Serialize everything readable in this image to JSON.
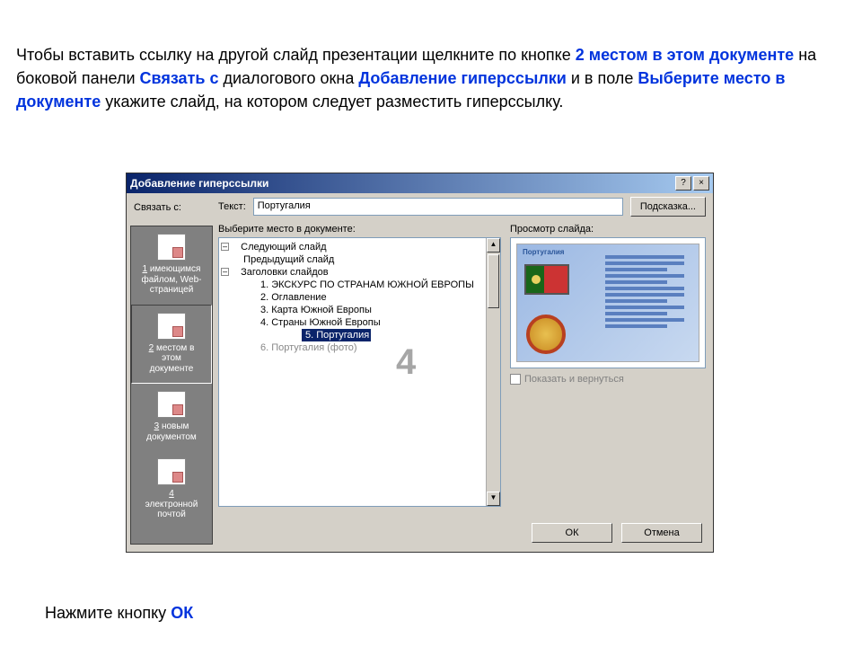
{
  "instruction": {
    "p1a": "Чтобы вставить ссылку на другой слайд презентации щелкните по кнопке ",
    "p1b": "2 местом в этом документе",
    "p1c": " на боковой панели ",
    "p1d": "Связать с",
    "p1e": " диалогового окна ",
    "p1f": "Добавление гиперссылки",
    "p1g": " и в поле ",
    "p1h": "Выберите место в документе",
    "p1i": " укажите слайд, на котором следует разместить гиперссылку."
  },
  "bottom": {
    "a": "Нажмите кнопку ",
    "b": "ОК"
  },
  "dialog": {
    "title": "Добавление гиперссылки",
    "link_with_label": "Связать с:",
    "text_label": "Текст:",
    "text_value": "Португалия",
    "hint_btn": "Подсказка...",
    "select_place_label": "Выберите место в документе:",
    "preview_label": "Просмотр слайда:",
    "checkbox": "Показать и вернуться",
    "ok": "ОК",
    "cancel": "Отмена",
    "overlay4": "4",
    "sidebar": [
      {
        "num": "1",
        "l1": "имеющимся",
        "l2": "файлом, Web-",
        "l3": "страницей"
      },
      {
        "num": "2",
        "l1": "местом в",
        "l2": "этом",
        "l3": "документе"
      },
      {
        "num": "3",
        "l1": "новым",
        "l2": "документом",
        "l3": ""
      },
      {
        "num": "4",
        "l1": "электронной",
        "l2": "почтой",
        "l3": ""
      }
    ],
    "tree": {
      "t1": "Следующий слайд",
      "t2": "Предыдущий слайд",
      "t3": "Заголовки слайдов",
      "s1": "1. ЭКСКУРС ПО СТРАНАМ ЮЖНОЙ ЕВРОПЫ",
      "s2": "2. Оглавление",
      "s3": "3. Карта Южной Европы",
      "s4": "4. Страны Южной Европы",
      "s5": "5. Португалия",
      "s6": "6. Португалия (фото)"
    },
    "preview_slide_title": "Португалия"
  }
}
